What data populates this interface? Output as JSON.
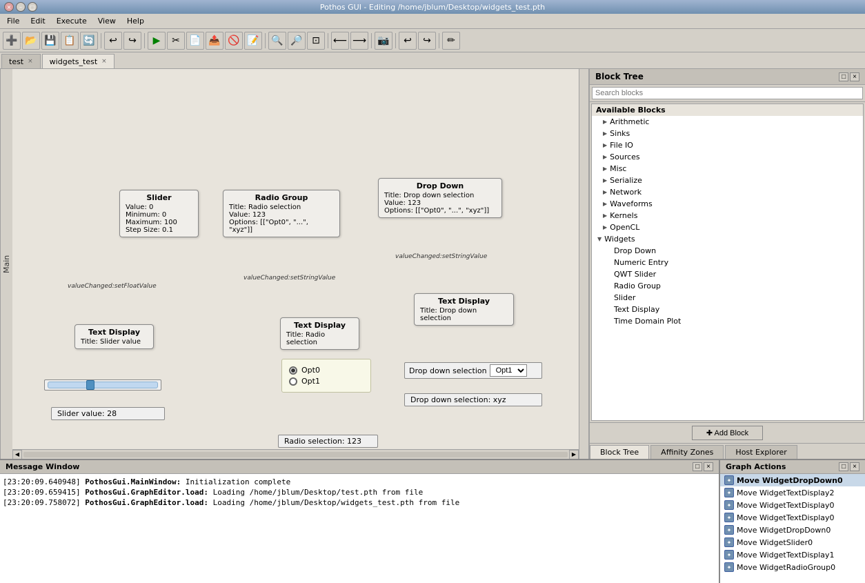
{
  "window": {
    "title": "Pothos GUI - Editing /home/jblum/Desktop/widgets_test.pth",
    "close_icon": "×",
    "min_icon": "–",
    "max_icon": "□"
  },
  "menubar": {
    "items": [
      "File",
      "Edit",
      "Execute",
      "View",
      "Help"
    ]
  },
  "toolbar": {
    "icons": [
      "➕",
      "💾",
      "💾",
      "💾",
      "🔄",
      "↩",
      "↪",
      "▶",
      "✂",
      "📋",
      "📤",
      "🚫",
      "📄",
      "🔍+",
      "🔍-",
      "🔍",
      "🔙",
      "🔜",
      "🎥",
      "↩",
      "↪",
      "✏"
    ]
  },
  "tabs": [
    {
      "label": "test",
      "active": false
    },
    {
      "label": "widgets_test",
      "active": true
    }
  ],
  "side_label": "Main",
  "block_tree": {
    "title": "Block Tree",
    "search_placeholder": "Search blocks",
    "section": "Available Blocks",
    "items": [
      {
        "label": "Arithmetic",
        "type": "collapsed"
      },
      {
        "label": "Sinks",
        "type": "collapsed"
      },
      {
        "label": "File IO",
        "type": "collapsed"
      },
      {
        "label": "Sources",
        "type": "collapsed"
      },
      {
        "label": "Misc",
        "type": "collapsed"
      },
      {
        "label": "Serialize",
        "type": "collapsed"
      },
      {
        "label": "Network",
        "type": "collapsed"
      },
      {
        "label": "Waveforms",
        "type": "collapsed"
      },
      {
        "label": "Kernels",
        "type": "collapsed"
      },
      {
        "label": "OpenCL",
        "type": "collapsed"
      },
      {
        "label": "Widgets",
        "type": "expanded"
      }
    ],
    "widgets_children": [
      "Drop Down",
      "Numeric Entry",
      "QWT Slider",
      "Radio Group",
      "Slider",
      "Text Display",
      "Time Domain Plot"
    ],
    "add_block_label": "✚ Add Block"
  },
  "panel_tabs": [
    {
      "label": "Block Tree",
      "active": true
    },
    {
      "label": "Affinity Zones",
      "active": false
    },
    {
      "label": "Host Explorer",
      "active": false
    }
  ],
  "canvas": {
    "blocks": {
      "slider": {
        "title": "Slider",
        "fields": [
          "Value: 0",
          "Minimum: 0",
          "Maximum: 100",
          "Step Size: 0.1"
        ],
        "conn": "valueChanged:setFloatValue"
      },
      "radio_group": {
        "title": "Radio Group",
        "fields": [
          "Title: Radio selection",
          "Value: 123",
          "Options: [[\"Opt0\", \"...\", \"xyz\"]]"
        ],
        "conn": "valueChanged:setStringValue"
      },
      "drop_down": {
        "title": "Drop Down",
        "fields": [
          "Title: Drop down selection",
          "Value: 123",
          "Options: [[\"Opt0\", \"...\", \"xyz\"]]"
        ],
        "conn": "valueChanged:setStringValue"
      },
      "text_display_1": {
        "title": "Text Display",
        "fields": [
          "Title: Slider value"
        ]
      },
      "text_display_2": {
        "title": "Text Display",
        "fields": [
          "Title: Radio selection"
        ]
      },
      "text_display_3": {
        "title": "Text Display",
        "fields": [
          "Title: Drop down selection"
        ]
      }
    },
    "widgets": {
      "slider_widget": {
        "value": "Slider value: 28"
      },
      "radio_label": {
        "value": "Radio selection: 123"
      },
      "dropdown_label": {
        "value": "Drop down selection: xyz"
      },
      "dropdown_select_label": "Drop down selection",
      "dropdown_select_value": "Opt1"
    }
  },
  "message_window": {
    "title": "Message Window",
    "lines": [
      {
        "timestamp": "[23:20:09.640948]",
        "source": "PothosGui.MainWindow:",
        "text": "Initialization complete"
      },
      {
        "timestamp": "[23:20:09.659415]",
        "source": "PothosGui.GraphEditor.load:",
        "text": "Loading /home/jblum/Desktop/test.pth from file"
      },
      {
        "timestamp": "[23:20:09.758072]",
        "source": "PothosGui.GraphEditor.load:",
        "text": "Loading /home/jblum/Desktop/widgets_test.pth from file"
      }
    ]
  },
  "graph_actions": {
    "title": "Graph Actions",
    "items": [
      {
        "label": "Move WidgetDropDown0",
        "bold": true
      },
      {
        "label": "Move WidgetTextDisplay2",
        "bold": false
      },
      {
        "label": "Move WidgetTextDisplay0",
        "bold": false
      },
      {
        "label": "Move WidgetTextDisplay0",
        "bold": false
      },
      {
        "label": "Move WidgetDropDown0",
        "bold": false
      },
      {
        "label": "Move WidgetSlider0",
        "bold": false
      },
      {
        "label": "Move WidgetTextDisplay1",
        "bold": false
      },
      {
        "label": "Move WidgetRadioGroup0",
        "bold": false
      }
    ]
  }
}
